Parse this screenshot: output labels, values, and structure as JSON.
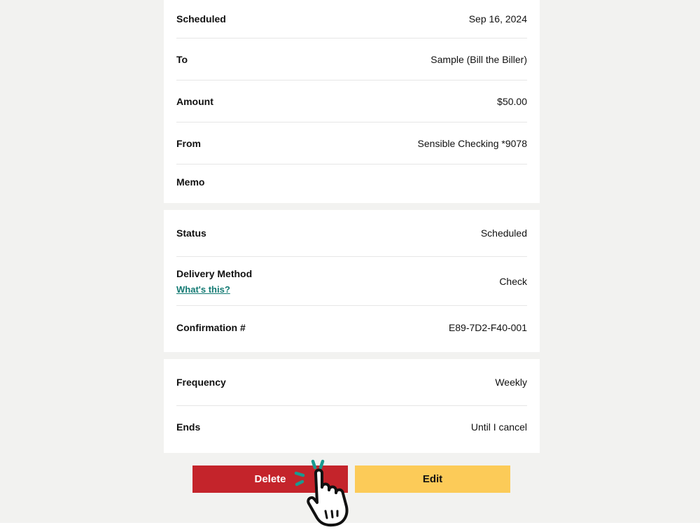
{
  "payment_details": [
    {
      "label": "Scheduled",
      "value": "Sep 16, 2024"
    },
    {
      "label": "To",
      "value": "Sample (Bill the Biller)"
    },
    {
      "label": "Amount",
      "value": "$50.00"
    },
    {
      "label": "From",
      "value": "Sensible Checking *9078"
    },
    {
      "label": "Memo",
      "value": ""
    }
  ],
  "status_details": {
    "status": {
      "label": "Status",
      "value": "Scheduled"
    },
    "delivery": {
      "label": "Delivery Method",
      "link": "What's this?",
      "value": "Check"
    },
    "confirmation": {
      "label": "Confirmation #",
      "value": "E89-7D2-F40-001"
    }
  },
  "recurrence": [
    {
      "label": "Frequency",
      "value": "Weekly"
    },
    {
      "label": "Ends",
      "value": "Until I cancel"
    }
  ],
  "actions": {
    "delete_label": "Delete",
    "edit_label": "Edit"
  },
  "colors": {
    "background": "#f2f2f0",
    "delete": "#c4242b",
    "edit": "#fccb58",
    "link": "#137a73",
    "click_accent": "#1a9a8f"
  },
  "overlay": {
    "icon": "hand-pointer-icon"
  }
}
